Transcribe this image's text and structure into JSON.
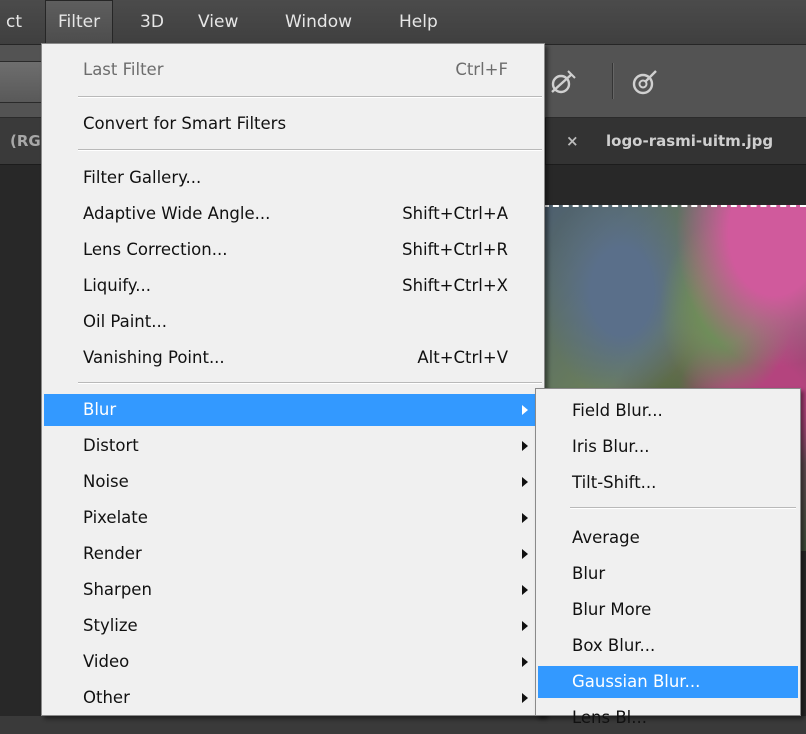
{
  "menubar": {
    "items": [
      {
        "label": "ct"
      },
      {
        "label": "Filter"
      },
      {
        "label": "3D"
      },
      {
        "label": "View"
      },
      {
        "label": "Window"
      },
      {
        "label": "Help"
      }
    ]
  },
  "tabs": {
    "left_label": "(RG",
    "close_glyph": "×",
    "doc_name": "logo-rasmi-uitm.jpg"
  },
  "filter_menu": {
    "last_filter": {
      "label": "Last Filter",
      "shortcut": "Ctrl+F"
    },
    "convert_smart": {
      "label": "Convert for Smart Filters"
    },
    "filter_gallery": {
      "label": "Filter Gallery..."
    },
    "adaptive_wide_angle": {
      "label": "Adaptive Wide Angle...",
      "shortcut": "Shift+Ctrl+A"
    },
    "lens_correction": {
      "label": "Lens Correction...",
      "shortcut": "Shift+Ctrl+R"
    },
    "liquify": {
      "label": "Liquify...",
      "shortcut": "Shift+Ctrl+X"
    },
    "oil_paint": {
      "label": "Oil Paint..."
    },
    "vanishing_point": {
      "label": "Vanishing Point...",
      "shortcut": "Alt+Ctrl+V"
    },
    "blur": {
      "label": "Blur"
    },
    "distort": {
      "label": "Distort"
    },
    "noise": {
      "label": "Noise"
    },
    "pixelate": {
      "label": "Pixelate"
    },
    "render": {
      "label": "Render"
    },
    "sharpen": {
      "label": "Sharpen"
    },
    "stylize": {
      "label": "Stylize"
    },
    "video": {
      "label": "Video"
    },
    "other": {
      "label": "Other"
    }
  },
  "blur_submenu": {
    "field_blur": {
      "label": "Field Blur..."
    },
    "iris_blur": {
      "label": "Iris Blur..."
    },
    "tilt_shift": {
      "label": "Tilt-Shift..."
    },
    "average": {
      "label": "Average"
    },
    "blur": {
      "label": "Blur"
    },
    "blur_more": {
      "label": "Blur More"
    },
    "box_blur": {
      "label": "Box Blur..."
    },
    "gaussian_blur": {
      "label": "Gaussian Blur..."
    },
    "lens_blur": {
      "label": "Lens Bl..."
    }
  },
  "colors": {
    "highlight": "#3399ff",
    "menu_bg": "#f0f0f0",
    "app_bg": "#3a3a3a"
  }
}
